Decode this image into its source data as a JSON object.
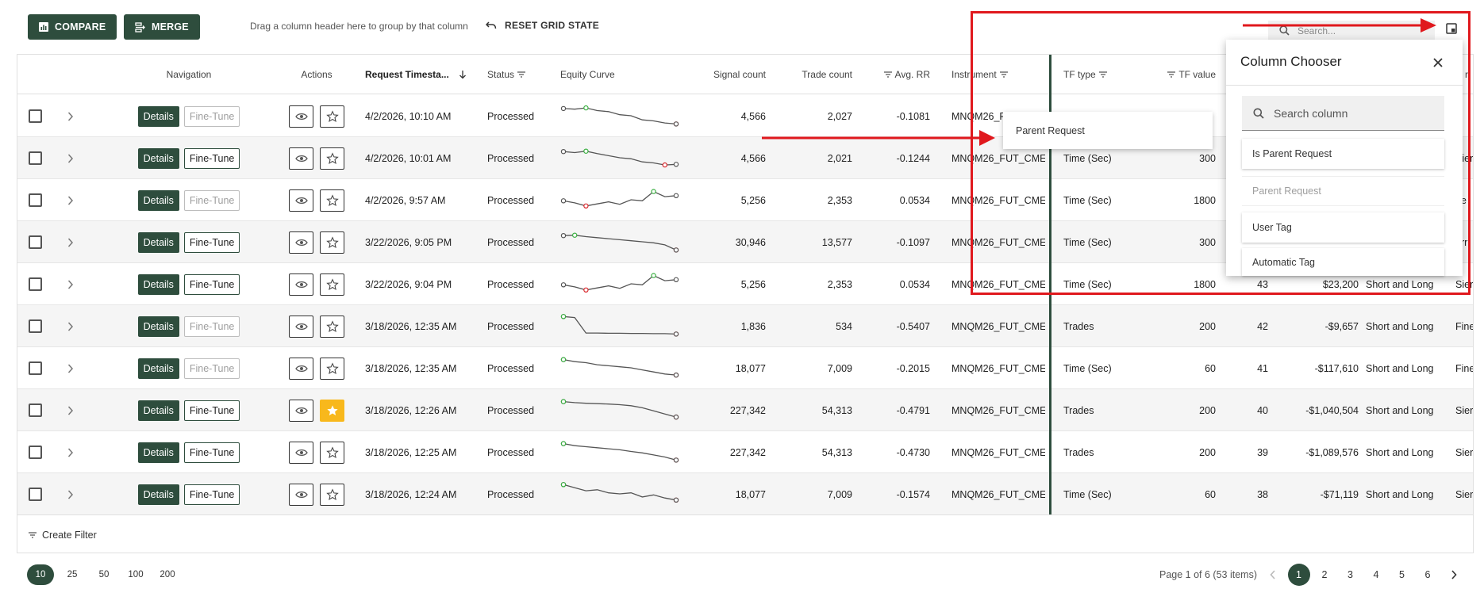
{
  "toolbar": {
    "compare_label": "COMPARE",
    "merge_label": "MERGE",
    "group_hint": "Drag a column header here to group by that column",
    "reset_label": "RESET GRID STATE",
    "search_placeholder": "Search..."
  },
  "columns": {
    "navigation": "Navigation",
    "actions": "Actions",
    "timestamp": "Request Timesta...",
    "status": "Status",
    "equity": "Equity Curve",
    "signal": "Signal count",
    "trade": "Trade count",
    "avgrr": "Avg. RR",
    "instrument": "Instrument",
    "tftype": "TF type",
    "tfvalue": "TF value",
    "partial": "ri"
  },
  "row_labels": {
    "details": "Details",
    "finetune": "Fine-Tune"
  },
  "rows": [
    {
      "ts": "4/2/2026, 10:10 AM",
      "status": "Processed",
      "signal": "4,566",
      "trade": "2,027",
      "rr": "-0.1081",
      "inst": "MNQM26_F",
      "tftype": "",
      "tfvalue": "",
      "id": "",
      "pnl": "",
      "dir": "",
      "src": "",
      "fine_enabled": false,
      "starred": false
    },
    {
      "ts": "4/2/2026, 10:01 AM",
      "status": "Processed",
      "signal": "4,566",
      "trade": "2,021",
      "rr": "-0.1244",
      "inst": "MNQM26_FUT_CME",
      "tftype": "Time (Sec)",
      "tfvalue": "300",
      "id": "",
      "pnl": "",
      "dir": "",
      "src": "Sierr",
      "fine_enabled": true,
      "starred": false
    },
    {
      "ts": "4/2/2026, 9:57 AM",
      "status": "Processed",
      "signal": "5,256",
      "trade": "2,353",
      "rr": "0.0534",
      "inst": "MNQM26_FUT_CME",
      "tftype": "Time (Sec)",
      "tfvalue": "1800",
      "id": "",
      "pnl": "",
      "dir": "",
      "src": "ne",
      "fine_enabled": false,
      "starred": false
    },
    {
      "ts": "3/22/2026, 9:05 PM",
      "status": "Processed",
      "signal": "30,946",
      "trade": "13,577",
      "rr": "-0.1097",
      "inst": "MNQM26_FUT_CME",
      "tftype": "Time (Sec)",
      "tfvalue": "300",
      "id": "",
      "pnl": "",
      "dir": "",
      "src": "err",
      "fine_enabled": true,
      "starred": false
    },
    {
      "ts": "3/22/2026, 9:04 PM",
      "status": "Processed",
      "signal": "5,256",
      "trade": "2,353",
      "rr": "0.0534",
      "inst": "MNQM26_FUT_CME",
      "tftype": "Time (Sec)",
      "tfvalue": "1800",
      "id": "43",
      "pnl": "$23,200",
      "dir": "Short and Long",
      "src": "Sierr",
      "fine_enabled": true,
      "starred": false
    },
    {
      "ts": "3/18/2026, 12:35 AM",
      "status": "Processed",
      "signal": "1,836",
      "trade": "534",
      "rr": "-0.5407",
      "inst": "MNQM26_FUT_CME",
      "tftype": "Trades",
      "tfvalue": "200",
      "id": "42",
      "pnl": "-$9,657",
      "dir": "Short and Long",
      "src": "Fine",
      "fine_enabled": false,
      "starred": false
    },
    {
      "ts": "3/18/2026, 12:35 AM",
      "status": "Processed",
      "signal": "18,077",
      "trade": "7,009",
      "rr": "-0.2015",
      "inst": "MNQM26_FUT_CME",
      "tftype": "Time (Sec)",
      "tfvalue": "60",
      "id": "41",
      "pnl": "-$117,610",
      "dir": "Short and Long",
      "src": "Fine",
      "fine_enabled": false,
      "starred": false
    },
    {
      "ts": "3/18/2026, 12:26 AM",
      "status": "Processed",
      "signal": "227,342",
      "trade": "54,313",
      "rr": "-0.4791",
      "inst": "MNQM26_FUT_CME",
      "tftype": "Trades",
      "tfvalue": "200",
      "id": "40",
      "pnl": "-$1,040,504",
      "dir": "Short and Long",
      "src": "Sierr",
      "fine_enabled": true,
      "starred": true
    },
    {
      "ts": "3/18/2026, 12:25 AM",
      "status": "Processed",
      "signal": "227,342",
      "trade": "54,313",
      "rr": "-0.4730",
      "inst": "MNQM26_FUT_CME",
      "tftype": "Trades",
      "tfvalue": "200",
      "id": "39",
      "pnl": "-$1,089,576",
      "dir": "Short and Long",
      "src": "Sierr",
      "fine_enabled": true,
      "starred": false
    },
    {
      "ts": "3/18/2026, 12:24 AM",
      "status": "Processed",
      "signal": "18,077",
      "trade": "7,009",
      "rr": "-0.1574",
      "inst": "MNQM26_FUT_CME",
      "tftype": "Time (Sec)",
      "tfvalue": "60",
      "id": "38",
      "pnl": "-$71,119",
      "dir": "Short and Long",
      "src": "Sierr",
      "fine_enabled": true,
      "starred": false
    }
  ],
  "footer": {
    "create_filter": "Create Filter"
  },
  "pager": {
    "sizes": [
      "10",
      "25",
      "50",
      "100",
      "200"
    ],
    "active_size": "10",
    "info": "Page 1 of 6 (53 items)",
    "pages": [
      "1",
      "2",
      "3",
      "4",
      "5",
      "6"
    ],
    "active_page": "1"
  },
  "drag_ghost": {
    "label": "Parent Request"
  },
  "chooser": {
    "title": "Column Chooser",
    "search_placeholder": "Search column",
    "items": [
      "Is Parent Request",
      "Parent Request",
      "User Tag",
      "Automatic Tag"
    ]
  },
  "colors": {
    "brand": "#2e4d3d",
    "star": "#f8b81c",
    "annotation": "#e0181d",
    "curve_start": "#3cb043",
    "curve_end": "#d9252a"
  },
  "equity_curves": [
    [
      0.15,
      0.18,
      0.12,
      0.25,
      0.3,
      0.45,
      0.5,
      0.7,
      0.75,
      0.85,
      0.9
    ],
    [
      0.2,
      0.25,
      0.18,
      0.3,
      0.4,
      0.5,
      0.55,
      0.7,
      0.75,
      0.85,
      0.82
    ],
    [
      0.55,
      0.65,
      0.8,
      0.7,
      0.6,
      0.72,
      0.5,
      0.55,
      0.1,
      0.35,
      0.3
    ],
    [
      0.2,
      0.18,
      0.25,
      0.3,
      0.35,
      0.4,
      0.45,
      0.5,
      0.55,
      0.65,
      0.9
    ],
    [
      0.55,
      0.65,
      0.8,
      0.7,
      0.6,
      0.72,
      0.5,
      0.55,
      0.1,
      0.35,
      0.3
    ],
    [
      0.05,
      0.1,
      0.85,
      0.85,
      0.86,
      0.86,
      0.87,
      0.87,
      0.88,
      0.88,
      0.9
    ],
    [
      0.1,
      0.2,
      0.25,
      0.35,
      0.4,
      0.45,
      0.5,
      0.6,
      0.7,
      0.8,
      0.85
    ],
    [
      0.1,
      0.15,
      0.18,
      0.2,
      0.22,
      0.25,
      0.3,
      0.4,
      0.55,
      0.7,
      0.85
    ],
    [
      0.1,
      0.2,
      0.25,
      0.3,
      0.35,
      0.4,
      0.48,
      0.55,
      0.65,
      0.75,
      0.9
    ],
    [
      0.05,
      0.2,
      0.35,
      0.3,
      0.45,
      0.5,
      0.45,
      0.65,
      0.55,
      0.7,
      0.8
    ]
  ]
}
